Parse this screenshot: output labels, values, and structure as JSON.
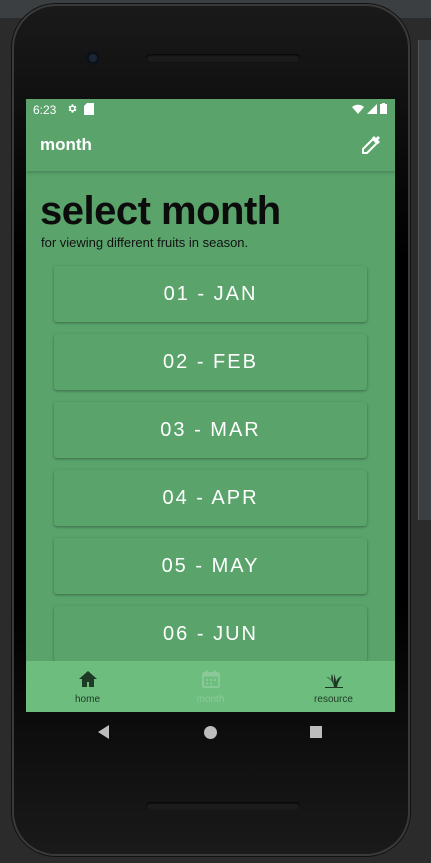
{
  "status_bar": {
    "time": "6:23",
    "left_icons": [
      "gear-icon",
      "sd-card-icon"
    ],
    "right_icons": [
      "wifi-icon",
      "signal-icon",
      "battery-icon"
    ]
  },
  "app_bar": {
    "title": "month",
    "action_icon": "eyedropper-icon"
  },
  "page": {
    "heading": "select month",
    "subheading": "for viewing different fruits in season."
  },
  "months": [
    {
      "label": "01 - JAN"
    },
    {
      "label": "02 - FEB"
    },
    {
      "label": "03 - MAR"
    },
    {
      "label": "04 - APR"
    },
    {
      "label": "05 - MAY"
    },
    {
      "label": "06 - JUN"
    }
  ],
  "bottom_nav": {
    "items": [
      {
        "label": "home",
        "icon": "home-icon",
        "active": false
      },
      {
        "label": "month",
        "icon": "calendar-icon",
        "active": true
      },
      {
        "label": "resource",
        "icon": "plant-icon",
        "active": false
      }
    ]
  },
  "colors": {
    "primary": "#5aa46c",
    "bottom_nav": "#6dbd7e",
    "nav_active": "#8cc99a",
    "nav_inactive": "#1e3a25"
  }
}
